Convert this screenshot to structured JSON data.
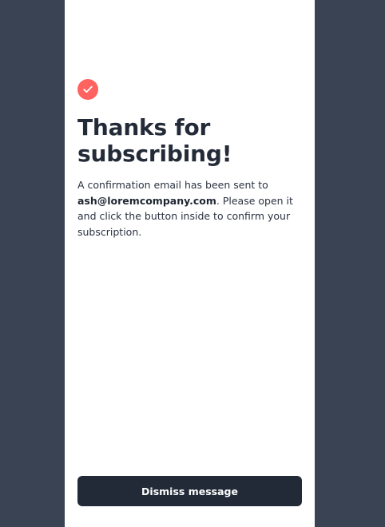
{
  "colors": {
    "background": "#3a4354",
    "card": "#ffffff",
    "accent": "#ff6360",
    "heading": "#242b38",
    "button": "#232a37"
  },
  "icon": "check-circle-icon",
  "title": "Thanks for subscribing!",
  "message": {
    "before_email": "A confirmation email has been sent to ",
    "email": "ash@loremcompany.com",
    "after_email": ". Please open it and click the button inside to confirm your subscription."
  },
  "dismiss_label": "Dismiss message"
}
